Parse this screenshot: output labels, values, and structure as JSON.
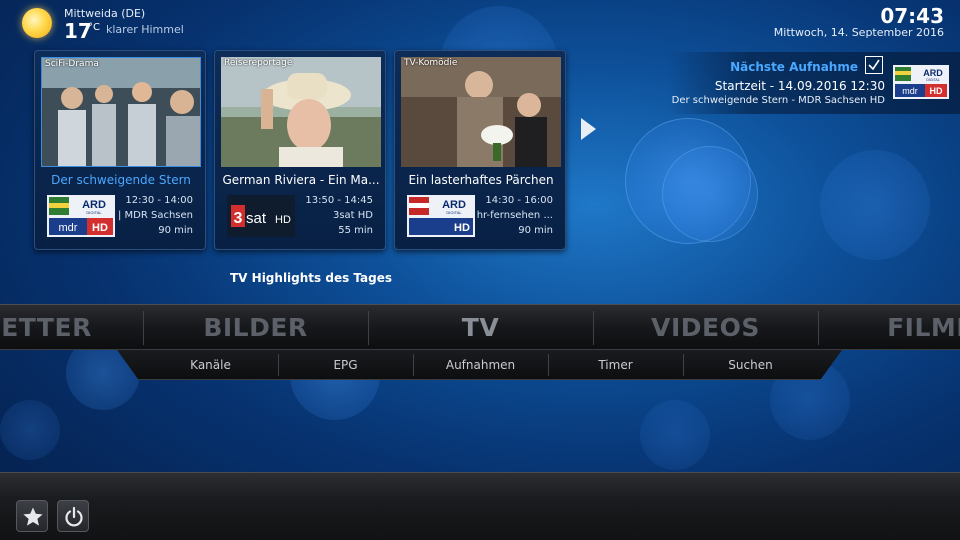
{
  "weather": {
    "location": "Mittweida (DE)",
    "temperature": "17",
    "unit": "°C",
    "condition": "klarer Himmel",
    "icon": "sun-icon"
  },
  "clock": {
    "time": "07:43",
    "date": "Mittwoch, 14. September 2016"
  },
  "next_recording": {
    "title": "Nächste Aufnahme",
    "start": "Startzeit - 14.09.2016 12:30",
    "program": "Der schweigende Stern - MDR Sachsen HD",
    "logo": "mdr-sachsen-hd-logo"
  },
  "highlights_label": "TV Highlights des Tages",
  "cards": [
    {
      "tag": "SciFi-Drama",
      "title": "Der schweigende Stern",
      "time": "12:30 - 14:00",
      "channel": "| MDR Sachsen",
      "duration": "90 min",
      "logo": "mdr-sachsen-hd-logo",
      "selected": true
    },
    {
      "tag": "Reisereportage",
      "title": "German Riviera - Ein Ma...",
      "time": "13:50 - 14:45",
      "channel": "3sat HD",
      "duration": "55 min",
      "logo": "3sat-hd-logo",
      "selected": false
    },
    {
      "tag": "TV-Komödie",
      "title": "Ein lasterhaftes Pärchen",
      "time": "14:30 - 16:00",
      "channel": "hr-fernsehen ...",
      "duration": "90 min",
      "logo": "hr-fernsehen-hd-logo",
      "selected": false
    }
  ],
  "logos": {
    "ard": "ARD",
    "ard_sub": "DIGITAL",
    "mdr": "mdr",
    "hd": "HD",
    "sat_num": "3",
    "sat_word": "sat",
    "sat_hd": "HD"
  },
  "main_menu": {
    "items": [
      "WETTER",
      "BILDER",
      "TV",
      "VIDEOS",
      "FILME"
    ],
    "active": "TV"
  },
  "sub_menu": [
    "Kanäle",
    "EPG",
    "Aufnahmen",
    "Timer",
    "Suchen"
  ],
  "bottom_buttons": [
    "favourites-star-icon",
    "power-icon"
  ],
  "colors": {
    "accent": "#4aa8ff",
    "background": "#0a3a7a",
    "menu_text": "#5c6068"
  }
}
